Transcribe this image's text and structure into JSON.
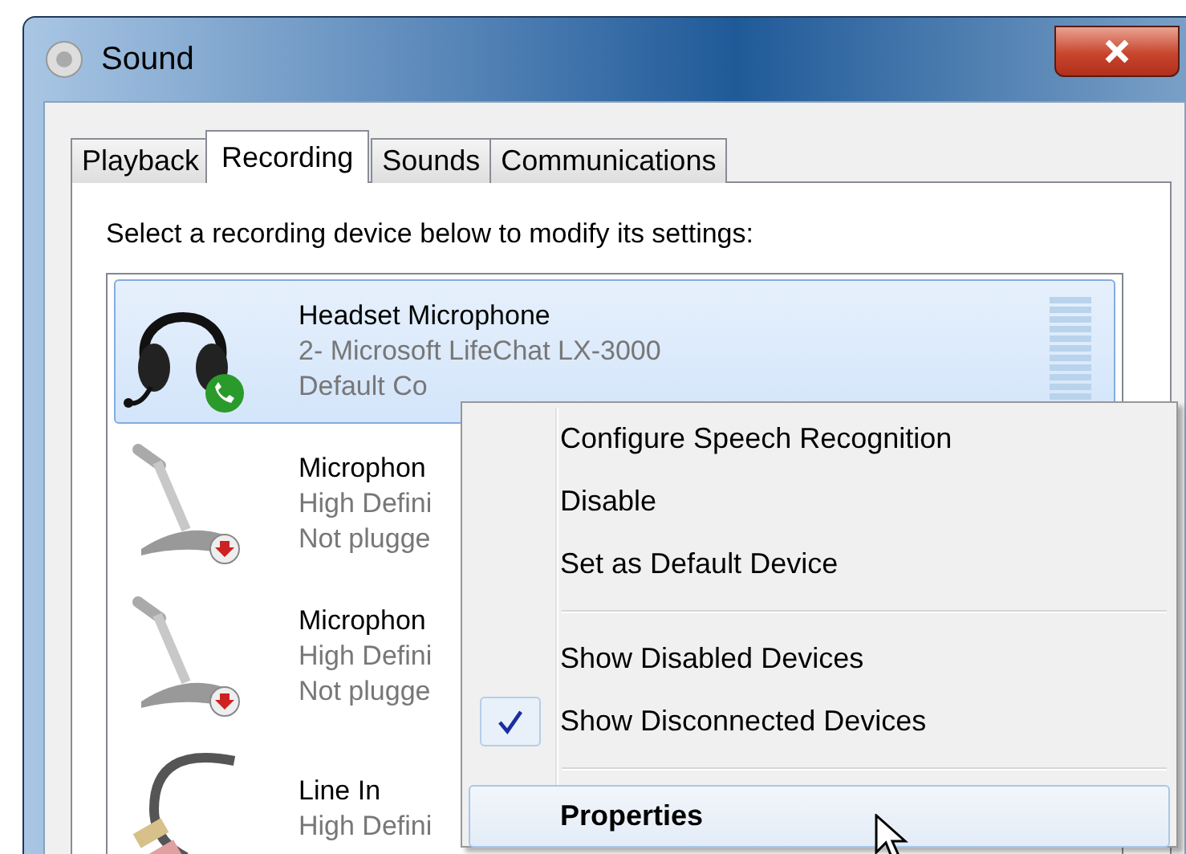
{
  "window": {
    "title": "Sound"
  },
  "tabs": [
    {
      "label": "Playback",
      "selected": false
    },
    {
      "label": "Recording",
      "selected": true
    },
    {
      "label": "Sounds",
      "selected": false
    },
    {
      "label": "Communications",
      "selected": false
    }
  ],
  "instruction": "Select a recording device below to modify its settings:",
  "devices": [
    {
      "kind": "headset",
      "name": "Headset Microphone",
      "description": "2- Microsoft LifeChat LX-3000",
      "status": "Default Co",
      "selected": true
    },
    {
      "kind": "microphone",
      "name": "Microphon",
      "description": "High Defini",
      "status": "Not plugge",
      "selected": false
    },
    {
      "kind": "microphone",
      "name": "Microphon",
      "description": "High Defini",
      "status": "Not plugge",
      "selected": false
    },
    {
      "kind": "line-in",
      "name": "Line In",
      "description": "High Defini",
      "selected": false
    }
  ],
  "context_menu": {
    "items": [
      {
        "kind": "item",
        "label": "Configure Speech Recognition",
        "checked": false,
        "selected": false,
        "default": false
      },
      {
        "kind": "item",
        "label": "Disable",
        "checked": false,
        "selected": false,
        "default": false
      },
      {
        "kind": "item",
        "label": "Set as Default Device",
        "checked": false,
        "selected": false,
        "default": false
      },
      {
        "kind": "separator"
      },
      {
        "kind": "item",
        "label": "Show Disabled Devices",
        "checked": false,
        "selected": false,
        "default": false
      },
      {
        "kind": "item",
        "label": "Show Disconnected Devices",
        "checked": true,
        "selected": false,
        "default": false
      },
      {
        "kind": "separator"
      },
      {
        "kind": "item",
        "label": "Properties",
        "checked": false,
        "selected": true,
        "default": true
      }
    ]
  }
}
